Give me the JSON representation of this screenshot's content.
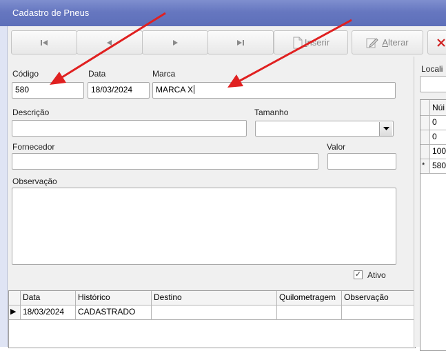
{
  "window": {
    "title": "Cadastro de Pneus"
  },
  "toolbar": {
    "first_icon": "first-record-icon",
    "prev_icon": "previous-record-icon",
    "next_icon": "next-record-icon",
    "last_icon": "last-record-icon",
    "insert_label_u": "I",
    "insert_label_rest": "nserir",
    "edit_label_u": "A",
    "edit_label_rest": "lterar"
  },
  "form": {
    "codigo_label": "Código",
    "codigo_value": "580",
    "data_label": "Data",
    "data_value": "18/03/2024",
    "marca_label": "Marca",
    "marca_value": "MARCA X",
    "descricao_label": "Descrição",
    "descricao_value": "",
    "tamanho_label": "Tamanho",
    "tamanho_value": "",
    "fornecedor_label": "Fornecedor",
    "fornecedor_value": "",
    "valor_label": "Valor",
    "valor_value": "",
    "observacao_label": "Observação",
    "observacao_value": "",
    "ativo_label": "Ativo",
    "ativo_checked": true
  },
  "history_grid": {
    "columns": [
      "Data",
      "Histórico",
      "Destino",
      "Quilometragem",
      "Observação"
    ],
    "rows": [
      {
        "indicator": "▶",
        "data": "18/03/2024",
        "historico": "CADASTRADO",
        "destino": "",
        "quilometragem": "",
        "observacao": ""
      }
    ]
  },
  "right_panel": {
    "local_label": "Locali",
    "local_value": "",
    "grid_header": "Núi",
    "rows": [
      "0",
      "0",
      "100",
      "580"
    ],
    "new_row_indicator": "*"
  },
  "annotation_color": "#e02020"
}
